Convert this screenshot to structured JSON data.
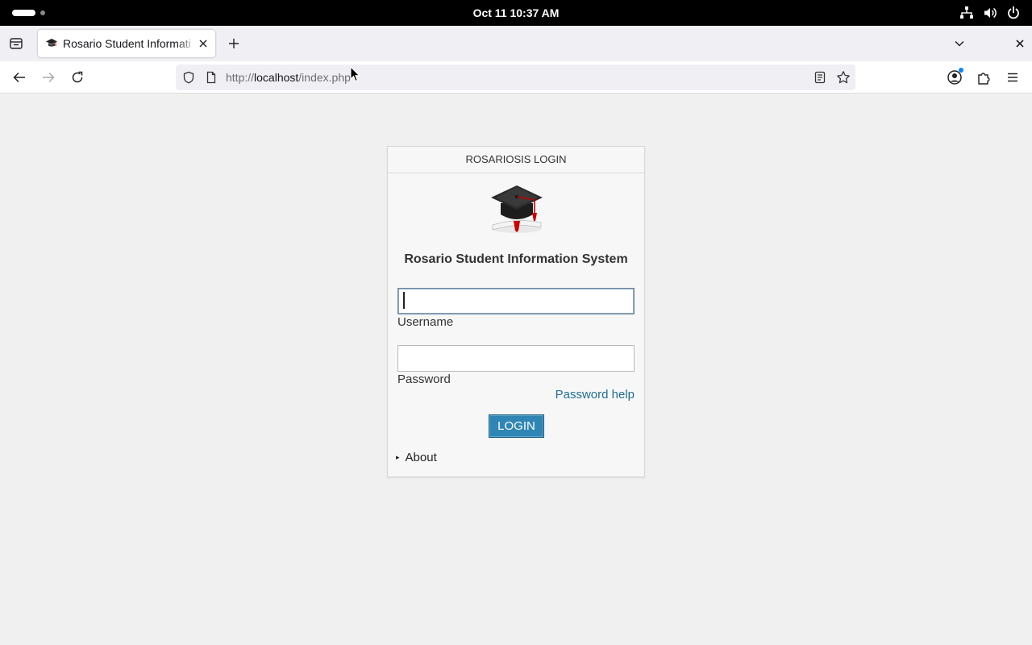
{
  "system_bar": {
    "clock": "Oct 11  10:37 AM"
  },
  "browser": {
    "tab": {
      "title": "Rosario Student Informati",
      "close_label": "×"
    },
    "new_tab_label": "+",
    "url": {
      "scheme": "http://",
      "host": "localhost",
      "path": "/index.php"
    }
  },
  "login": {
    "header": "ROSARIOSIS LOGIN",
    "system_name": "Rosario Student Information System",
    "username_label": "Username",
    "username_value": "",
    "password_label": "Password",
    "password_value": "",
    "password_help": "Password help",
    "login_button": "LOGIN",
    "about_marker": "▸",
    "about_label": "About"
  },
  "colors": {
    "login_button": "#2f86b4",
    "link": "#1f6e93",
    "page_background": "#f0f0f0"
  }
}
